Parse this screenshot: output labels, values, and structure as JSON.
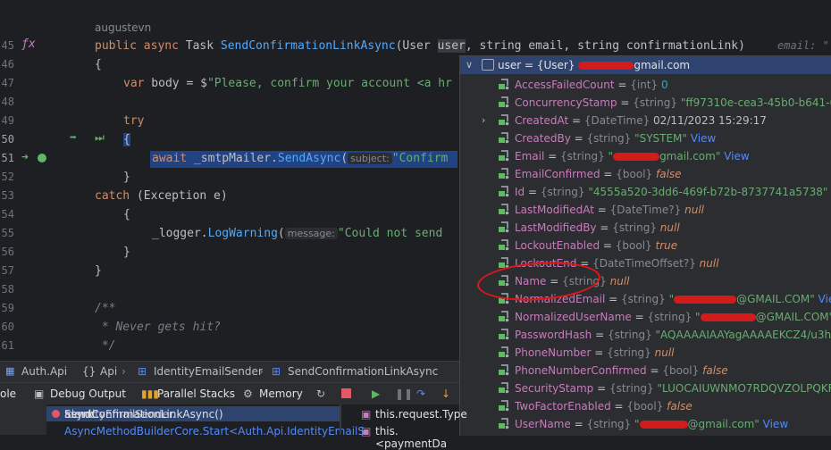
{
  "editor": {
    "author": "augustevn",
    "line_numbers": [
      "45",
      "46",
      "47",
      "48",
      "49",
      "50",
      "51",
      "52",
      "53",
      "54",
      "55",
      "56",
      "57",
      "58",
      "59",
      "60",
      "61"
    ],
    "line45": {
      "kw1": "public",
      "kw2": "async",
      "type": "Task",
      "method": "SendConfirmationLinkAsync",
      "p1": "(User",
      "p1name": "user",
      ",": ",",
      "p2": " string email, string confirmationLink)"
    },
    "line45_hint": "email: \"",
    "line46": "{",
    "line47": {
      "kw": "var",
      "rest1": " body = $",
      "str": "\"Please, confirm your account <a hr"
    },
    "line49": "try",
    "line50": "{",
    "line51": {
      "kw": "await",
      "obj": " _smtpMailer.",
      "fn": "SendAsync",
      "open": "(",
      "hint": "subject:",
      "str": "\"Confirm"
    },
    "line52": "}",
    "line53": {
      "kw": "catch",
      "rest": " (Exception e)"
    },
    "line54": "{",
    "line55": {
      "obj": "_logger.",
      "fn": "LogWarning",
      "open": "(",
      "hint": "message:",
      "str": "\"Could not send"
    },
    "line56": "}",
    "line57": "}",
    "line59": "/**",
    "line60": " * Never gets hit?",
    "line61": " */"
  },
  "popup": {
    "header": {
      "name": "user",
      "eq": " = ",
      "type": "{User}",
      "suffix": "gmail.com"
    },
    "rows": [
      {
        "name": "AccessFailedCount",
        "type": "{int}",
        "value": "0",
        "kind": "num",
        "view": ""
      },
      {
        "name": "ConcurrencyStamp",
        "type": "{string}",
        "value": "\"ff97310e-cea3-45b0-b641-6e519ec49",
        "kind": "str",
        "view": ""
      },
      {
        "name": "CreatedAt",
        "type": "{DateTime}",
        "value": "02/11/2023 15:29:17",
        "kind": "plain",
        "view": ""
      },
      {
        "name": "CreatedBy",
        "type": "{string}",
        "value": "\"SYSTEM\"",
        "kind": "str",
        "view": "View"
      },
      {
        "name": "Email",
        "type": "{string}",
        "value": "gmail.com\"",
        "kind": "str",
        "view": "View"
      },
      {
        "name": "EmailConfirmed",
        "type": "{bool}",
        "value": "false",
        "kind": "kw",
        "view": ""
      },
      {
        "name": "Id",
        "type": "{string}",
        "value": "\"4555a520-3dd6-469f-b72b-8737741a5738\"",
        "kind": "str",
        "view": "View"
      },
      {
        "name": "LastModifiedAt",
        "type": "{DateTime?}",
        "value": "null",
        "kind": "kw",
        "view": ""
      },
      {
        "name": "LastModifiedBy",
        "type": "{string}",
        "value": "null",
        "kind": "kw",
        "view": ""
      },
      {
        "name": "LockoutEnabled",
        "type": "{bool}",
        "value": "true",
        "kind": "kw",
        "view": ""
      },
      {
        "name": "LockoutEnd",
        "type": "{DateTimeOffset?}",
        "value": "null",
        "kind": "kw",
        "view": ""
      },
      {
        "name": "Name",
        "type": "{string}",
        "value": "null",
        "kind": "kw",
        "view": ""
      },
      {
        "name": "NormalizedEmail",
        "type": "{string}",
        "value": "@GMAIL.COM\"",
        "kind": "str",
        "view": "View"
      },
      {
        "name": "NormalizedUserName",
        "type": "{string}",
        "value": "@GMAIL.COM\"",
        "kind": "str",
        "view": "View"
      },
      {
        "name": "PasswordHash",
        "type": "{string}",
        "value": "\"AQAAAAIAAYagAAAAEKCZ4/u3hlETjs661",
        "kind": "str",
        "view": ""
      },
      {
        "name": "PhoneNumber",
        "type": "{string}",
        "value": "null",
        "kind": "kw",
        "view": ""
      },
      {
        "name": "PhoneNumberConfirmed",
        "type": "{bool}",
        "value": "false",
        "kind": "kw",
        "view": ""
      },
      {
        "name": "SecurityStamp",
        "type": "{string}",
        "value": "\"LUOCAIUWNMO7RDQVZOLPQKR257G4D",
        "kind": "str",
        "view": ""
      },
      {
        "name": "TwoFactorEnabled",
        "type": "{bool}",
        "value": "false",
        "kind": "kw",
        "view": ""
      },
      {
        "name": "UserName",
        "type": "{string}",
        "value": "@gmail.com\"",
        "kind": "str",
        "view": "View"
      }
    ]
  },
  "breadcrumb": {
    "project": "Auth.Api",
    "namespace": "Api",
    "class": "IdentityEmailSender",
    "method": "SendConfirmationLinkAsync"
  },
  "debugbar": {
    "console": "ole",
    "debug_output": "Debug Output",
    "parallel": "Parallel Stacks",
    "memory": "Memory"
  },
  "frames": {
    "f1_kw": "async",
    "f1": "IdentityEmailSender.",
    "f1_method": "SendConfirmationLinkAsync()",
    "f2": "AsyncMethodBuilderCore.Start<Auth.Api.IdentityEmailS",
    "w1": "this.request.Type",
    "w2": "this.<paymentDa"
  },
  "colors": {
    "accent": "#2e436e",
    "selection": "#214283",
    "redaction": "#d41b1b"
  }
}
